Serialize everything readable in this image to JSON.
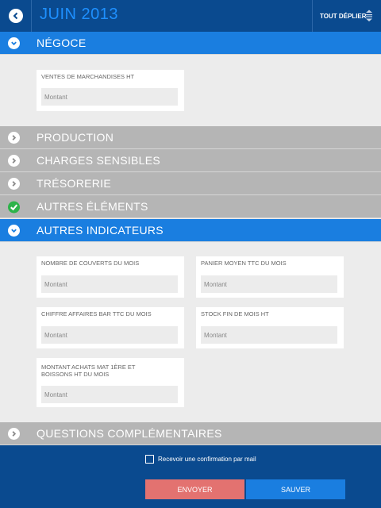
{
  "header": {
    "title": "JUIN 2013",
    "expand_all_label": "TOUT DÉPLIER"
  },
  "sections": {
    "negoce": {
      "label": "NÉGOCE",
      "state": "open"
    },
    "production": {
      "label": "PRODUCTION",
      "state": "closed"
    },
    "charges": {
      "label": "CHARGES SENSIBLES",
      "state": "closed"
    },
    "tresorerie": {
      "label": "TRÉSORERIE",
      "state": "closed"
    },
    "autres_elements": {
      "label": "AUTRES ÉLÉMENTS",
      "state": "completed"
    },
    "autres_indicateurs": {
      "label": "AUTRES INDICATEURS",
      "state": "open"
    },
    "questions": {
      "label": "QUESTIONS COMPLÉMENTAIRES",
      "state": "closed"
    }
  },
  "negoce_fields": {
    "ventes": {
      "label": "VENTES DE MARCHANDISES HT",
      "placeholder": "Montant"
    }
  },
  "indicateurs_fields": {
    "couverts": {
      "label": "NOMBRE DE COUVERTS DU MOIS",
      "placeholder": "Montant"
    },
    "panier": {
      "label": "PANIER MOYEN TTC DU MOIS",
      "placeholder": "Montant"
    },
    "chiffre_bar": {
      "label": "CHIFFRE AFFAIRES BAR TTC DU MOIS",
      "placeholder": "Montant"
    },
    "stock": {
      "label": "STOCK FIN DE MOIS HT",
      "placeholder": "Montant"
    },
    "achats": {
      "label": "MONTANT ACHATS MAT 1ÈRE ET BOISSONS HT DU MOIS",
      "placeholder": "Montant"
    }
  },
  "footer": {
    "confirm_label": "Recevoir une confirmation par mail",
    "confirm_checked": false,
    "send_label": "ENVOYER",
    "save_label": "SAUVER"
  },
  "colors": {
    "header_bg": "#0a4a8f",
    "title": "#1e90ff",
    "section_open": "#1a7ee0",
    "section_closed": "#b5b5b5",
    "check_green": "#2db34a",
    "send_button": "#e37270",
    "save_button": "#1a7ee0"
  },
  "icons": {
    "back": "chevron-left-circle-icon",
    "expand_all": "expand-arrows-icon",
    "open": "chevron-down-circle-icon",
    "closed": "chevron-right-circle-icon",
    "completed": "checkmark-icon"
  }
}
